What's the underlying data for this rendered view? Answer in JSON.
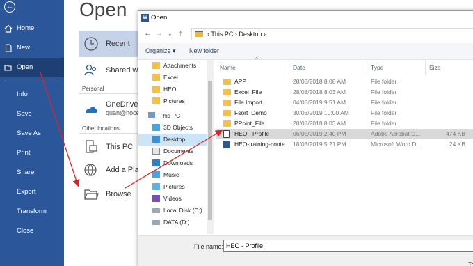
{
  "nav": {
    "items": [
      {
        "label": "Home"
      },
      {
        "label": "New"
      },
      {
        "label": "Open"
      },
      {
        "label": "Info"
      },
      {
        "label": "Save"
      },
      {
        "label": "Save As"
      },
      {
        "label": "Print"
      },
      {
        "label": "Share"
      },
      {
        "label": "Export"
      },
      {
        "label": "Transform"
      },
      {
        "label": "Close"
      }
    ]
  },
  "open_panel": {
    "title": "Open",
    "recent": "Recent",
    "shared": "Shared wi",
    "personal_label": "Personal",
    "onedrive": "OneDrive",
    "onedrive_sub": "quan@hoce",
    "other_label": "Other locations",
    "this_pc": "This PC",
    "add_place": "Add a Pla",
    "browse": "Browse"
  },
  "dialog": {
    "title": "Open",
    "breadcrumb": [
      "This PC",
      "Desktop"
    ],
    "organize": "Organize ▾",
    "new_folder": "New folder",
    "tree": [
      {
        "label": "Attachments"
      },
      {
        "label": "Excel"
      },
      {
        "label": "HEO"
      },
      {
        "label": "Pictures"
      },
      {
        "label": "This PC"
      },
      {
        "label": "3D Objects"
      },
      {
        "label": "Desktop"
      },
      {
        "label": "Documents"
      },
      {
        "label": "Downloads"
      },
      {
        "label": "Music"
      },
      {
        "label": "Pictures"
      },
      {
        "label": "Videos"
      },
      {
        "label": "Local Disk (C:)"
      },
      {
        "label": "DATA (D:)"
      }
    ],
    "columns": {
      "name": "Name",
      "date": "Date",
      "type": "Type",
      "size": "Size"
    },
    "files": [
      {
        "name": "APP",
        "date": "28/08/2018 8:08 AM",
        "type": "File folder",
        "size": ""
      },
      {
        "name": "Excel_File",
        "date": "28/08/2018 8:03 AM",
        "type": "File folder",
        "size": ""
      },
      {
        "name": "File Import",
        "date": "04/05/2019 9:51 AM",
        "type": "File folder",
        "size": ""
      },
      {
        "name": "Fsort_Demo",
        "date": "30/03/2019 10:00 AM",
        "type": "File folder",
        "size": ""
      },
      {
        "name": "PPoint_File",
        "date": "28/08/2018 8:03 AM",
        "type": "File folder",
        "size": ""
      },
      {
        "name": "HEO - Profile",
        "date": "06/05/2019 2:40 PM",
        "type": "Adobe Acrobat D...",
        "size": "474 KB"
      },
      {
        "name": "HEO-training-conte...",
        "date": "18/03/2019 5:21 PM",
        "type": "Microsoft Word D...",
        "size": "24 KB"
      }
    ],
    "file_name_label": "File name:",
    "file_name_value": "HEO - Profile",
    "to_label": "To"
  }
}
